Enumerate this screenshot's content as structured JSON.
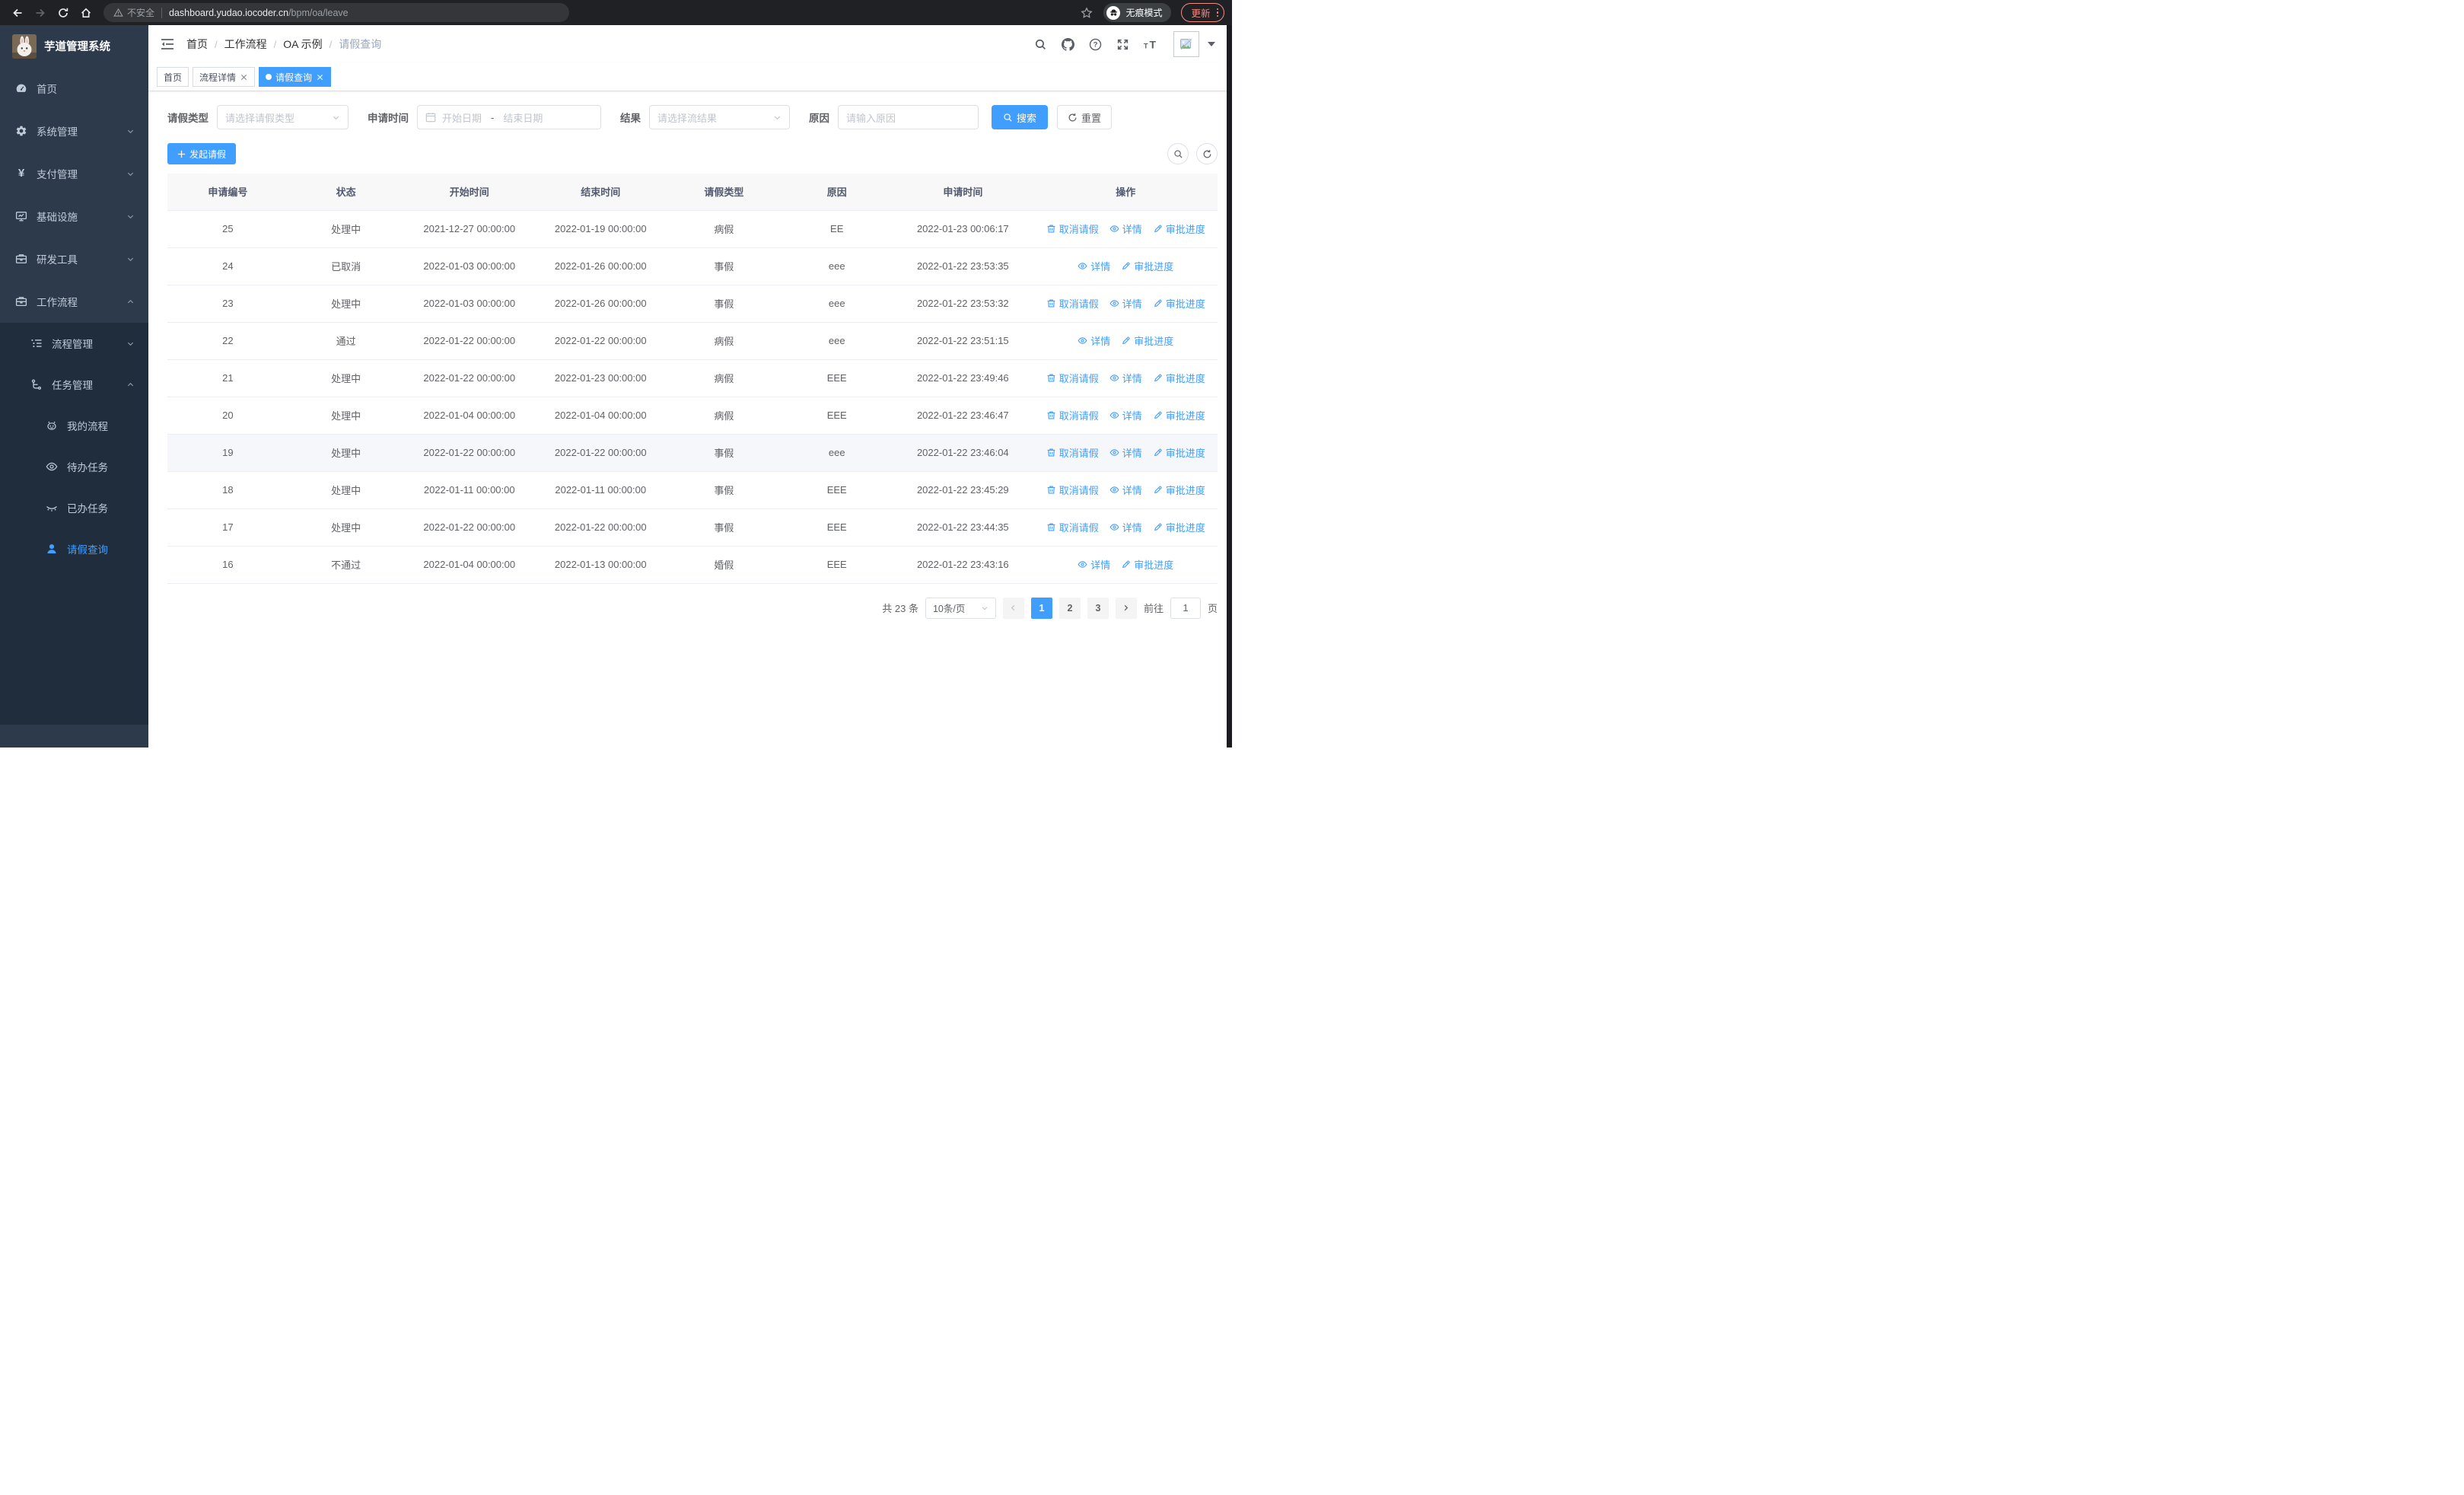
{
  "browser": {
    "security_label": "不安全",
    "url_host": "dashboard.yudao.iocoder.cn",
    "url_path": "/bpm/oa/leave",
    "incognito_label": "无痕模式",
    "update_label": "更新"
  },
  "sidebar": {
    "title": "芋道管理系统",
    "items": [
      {
        "label": "首页"
      },
      {
        "label": "系统管理"
      },
      {
        "label": "支付管理"
      },
      {
        "label": "基础设施"
      },
      {
        "label": "研发工具"
      },
      {
        "label": "工作流程",
        "expanded": true,
        "children": [
          {
            "label": "流程管理"
          },
          {
            "label": "任务管理",
            "expanded": true,
            "children": [
              {
                "label": "我的流程"
              },
              {
                "label": "待办任务"
              },
              {
                "label": "已办任务"
              },
              {
                "label": "请假查询",
                "active": true
              }
            ]
          }
        ]
      }
    ]
  },
  "header": {
    "breadcrumb": [
      "首页",
      "工作流程",
      "OA 示例",
      "请假查询"
    ],
    "separator": "/"
  },
  "tags": [
    {
      "label": "首页",
      "active": false,
      "closable": false
    },
    {
      "label": "流程详情",
      "active": false,
      "closable": true
    },
    {
      "label": "请假查询",
      "active": true,
      "closable": true
    }
  ],
  "filters": {
    "leave_type_label": "请假类型",
    "leave_type_placeholder": "请选择请假类型",
    "apply_time_label": "申请时间",
    "start_placeholder": "开始日期",
    "range_separator": "-",
    "end_placeholder": "结束日期",
    "result_label": "结果",
    "result_placeholder": "请选择流结果",
    "reason_label": "原因",
    "reason_placeholder": "请输入原因",
    "search_label": "搜索",
    "reset_label": "重置"
  },
  "toolbar": {
    "create_label": "发起请假"
  },
  "table": {
    "columns": [
      "申请编号",
      "状态",
      "开始时间",
      "结束时间",
      "请假类型",
      "原因",
      "申请时间",
      "操作"
    ],
    "action_labels": {
      "cancel": "取消请假",
      "detail": "详情",
      "progress": "审批进度"
    },
    "rows": [
      {
        "id": "25",
        "status": "处理中",
        "start": "2021-12-27 00:00:00",
        "end": "2022-01-19 00:00:00",
        "type": "病假",
        "reason": "EE",
        "applied": "2022-01-23 00:06:17",
        "actions": [
          "cancel",
          "detail",
          "progress"
        ],
        "highlight": false
      },
      {
        "id": "24",
        "status": "已取消",
        "start": "2022-01-03 00:00:00",
        "end": "2022-01-26 00:00:00",
        "type": "事假",
        "reason": "eee",
        "applied": "2022-01-22 23:53:35",
        "actions": [
          "detail",
          "progress"
        ],
        "highlight": false
      },
      {
        "id": "23",
        "status": "处理中",
        "start": "2022-01-03 00:00:00",
        "end": "2022-01-26 00:00:00",
        "type": "事假",
        "reason": "eee",
        "applied": "2022-01-22 23:53:32",
        "actions": [
          "cancel",
          "detail",
          "progress"
        ],
        "highlight": false
      },
      {
        "id": "22",
        "status": "通过",
        "start": "2022-01-22 00:00:00",
        "end": "2022-01-22 00:00:00",
        "type": "病假",
        "reason": "eee",
        "applied": "2022-01-22 23:51:15",
        "actions": [
          "detail",
          "progress"
        ],
        "highlight": false
      },
      {
        "id": "21",
        "status": "处理中",
        "start": "2022-01-22 00:00:00",
        "end": "2022-01-23 00:00:00",
        "type": "病假",
        "reason": "EEE",
        "applied": "2022-01-22 23:49:46",
        "actions": [
          "cancel",
          "detail",
          "progress"
        ],
        "highlight": false
      },
      {
        "id": "20",
        "status": "处理中",
        "start": "2022-01-04 00:00:00",
        "end": "2022-01-04 00:00:00",
        "type": "病假",
        "reason": "EEE",
        "applied": "2022-01-22 23:46:47",
        "actions": [
          "cancel",
          "detail",
          "progress"
        ],
        "highlight": false
      },
      {
        "id": "19",
        "status": "处理中",
        "start": "2022-01-22 00:00:00",
        "end": "2022-01-22 00:00:00",
        "type": "事假",
        "reason": "eee",
        "applied": "2022-01-22 23:46:04",
        "actions": [
          "cancel",
          "detail",
          "progress"
        ],
        "highlight": true
      },
      {
        "id": "18",
        "status": "处理中",
        "start": "2022-01-11 00:00:00",
        "end": "2022-01-11 00:00:00",
        "type": "事假",
        "reason": "EEE",
        "applied": "2022-01-22 23:45:29",
        "actions": [
          "cancel",
          "detail",
          "progress"
        ],
        "highlight": false
      },
      {
        "id": "17",
        "status": "处理中",
        "start": "2022-01-22 00:00:00",
        "end": "2022-01-22 00:00:00",
        "type": "事假",
        "reason": "EEE",
        "applied": "2022-01-22 23:44:35",
        "actions": [
          "cancel",
          "detail",
          "progress"
        ],
        "highlight": false
      },
      {
        "id": "16",
        "status": "不通过",
        "start": "2022-01-04 00:00:00",
        "end": "2022-01-13 00:00:00",
        "type": "婚假",
        "reason": "EEE",
        "applied": "2022-01-22 23:43:16",
        "actions": [
          "detail",
          "progress"
        ],
        "highlight": false
      }
    ]
  },
  "pagination": {
    "total_label": "共 23 条",
    "page_size_label": "10条/页",
    "pages": [
      "1",
      "2",
      "3"
    ],
    "active_page": "1",
    "goto_label": "前往",
    "goto_value": "1",
    "page_unit": "页"
  },
  "colors": {
    "accent": "#409eff",
    "sidebar_bg": "#2d3a4b",
    "submenu_bg": "#1f2d3d",
    "update_button": "#f28b82"
  }
}
